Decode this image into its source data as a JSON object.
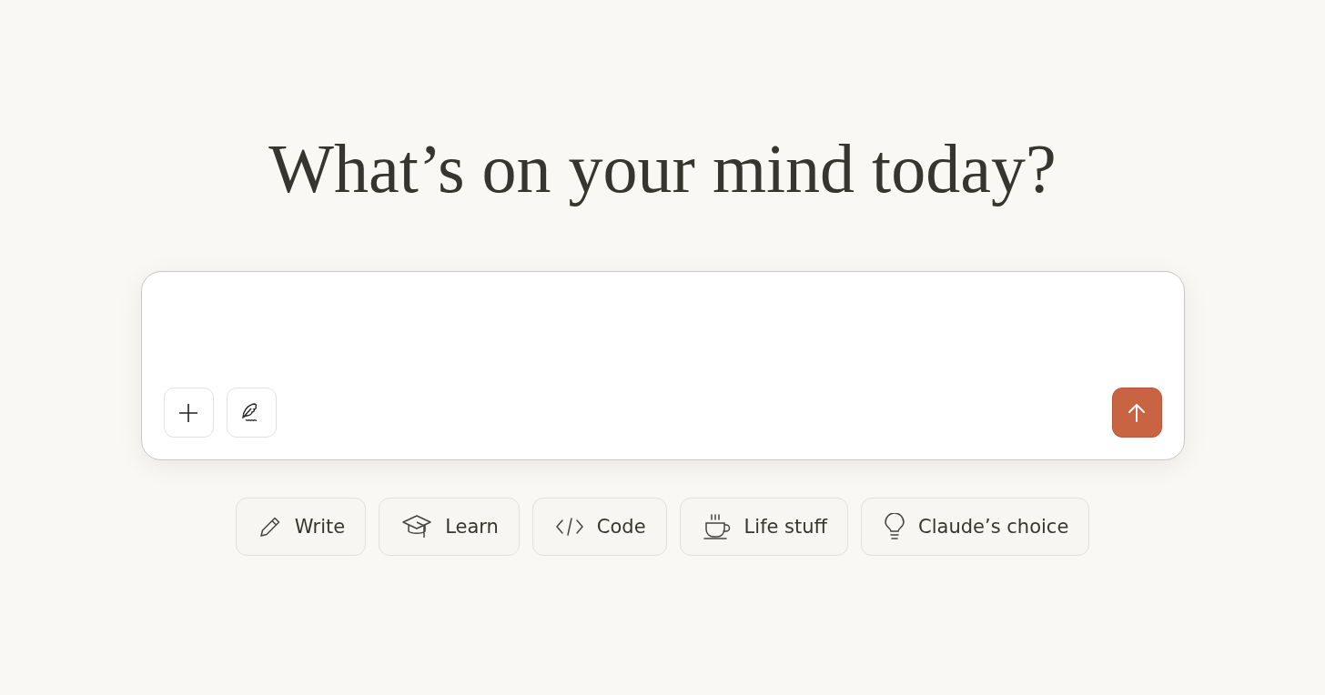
{
  "heading": "What’s on your mind today?",
  "composer": {
    "tools": [
      {
        "kind": "add"
      },
      {
        "kind": "style"
      }
    ],
    "send": {
      "kind": "send"
    }
  },
  "suggestions": [
    {
      "label": "Write",
      "kind": "pencil"
    },
    {
      "label": "Learn",
      "kind": "cap"
    },
    {
      "label": "Code",
      "kind": "code"
    },
    {
      "label": "Life stuff",
      "kind": "cup"
    },
    {
      "label": "Claude’s choice",
      "kind": "bulb"
    }
  ]
}
